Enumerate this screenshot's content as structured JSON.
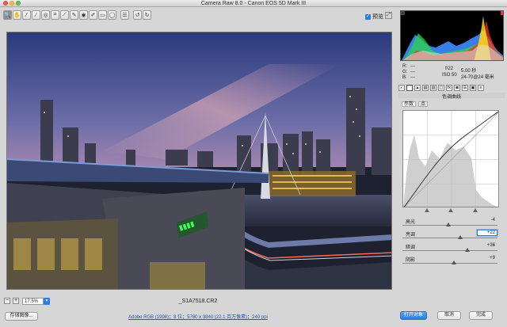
{
  "window": {
    "title": "Camera Raw 8.0 -  Canon EOS 5D Mark III"
  },
  "toolbar": {
    "tools": [
      {
        "name": "zoom-tool",
        "glyph": "🔍",
        "active": true
      },
      {
        "name": "hand-tool",
        "glyph": "✋"
      },
      {
        "name": "white-balance-tool",
        "glyph": "⁄"
      },
      {
        "name": "color-sampler-tool",
        "glyph": "⁄"
      },
      {
        "name": "targeted-adjustment-tool",
        "glyph": "◎"
      },
      {
        "name": "crop-tool",
        "glyph": "⌗"
      },
      {
        "name": "straighten-tool",
        "glyph": "⟋"
      },
      {
        "name": "spot-removal-tool",
        "glyph": "✎"
      },
      {
        "name": "red-eye-tool",
        "glyph": "◉"
      },
      {
        "name": "adjustment-brush-tool",
        "glyph": "✐"
      },
      {
        "name": "graduated-filter-tool",
        "glyph": "▭"
      },
      {
        "name": "radial-filter-tool",
        "glyph": "◯"
      },
      {
        "name": "preferences-tool",
        "glyph": "☰"
      },
      {
        "name": "rotate-ccw-tool",
        "glyph": "↺"
      },
      {
        "name": "rotate-cw-tool",
        "glyph": "↻"
      }
    ],
    "preview_label": "预览"
  },
  "status": {
    "zoom": "17.5%",
    "filename": "_S1A7518.CR2"
  },
  "info": {
    "r_label": "R:",
    "r_value": "---",
    "g_label": "G:",
    "g_value": "---",
    "b_label": "B:",
    "b_value": "---",
    "aperture": "f/22",
    "shutter": "5.00 秒",
    "iso": "ISO 50",
    "lens": "24-70@24 毫米"
  },
  "panel": {
    "title": "色调曲线",
    "subtabs": [
      "参数",
      "点"
    ],
    "sliders": [
      {
        "label": "高光",
        "value": "-4",
        "level": -4
      },
      {
        "label": "亮调",
        "value": "+22",
        "level": 22,
        "focused": true
      },
      {
        "label": "暗调",
        "value": "+36",
        "level": 36
      },
      {
        "label": "阴影",
        "value": "+9",
        "level": 9
      }
    ]
  },
  "bottom": {
    "save_label": "存储图像...",
    "workflow_link": "Adobe RGB (1998)；8 位；5760 x 3840 (22.1 百万像素)；240 ppi",
    "open_label": "打开对象",
    "cancel_label": "取消",
    "done_label": "完成"
  },
  "colors": {
    "accent": "#2d7de0",
    "sign_green": "#3cff5a",
    "sky_top": "#2b3a78",
    "sky_pink": "#e7a7b4"
  }
}
